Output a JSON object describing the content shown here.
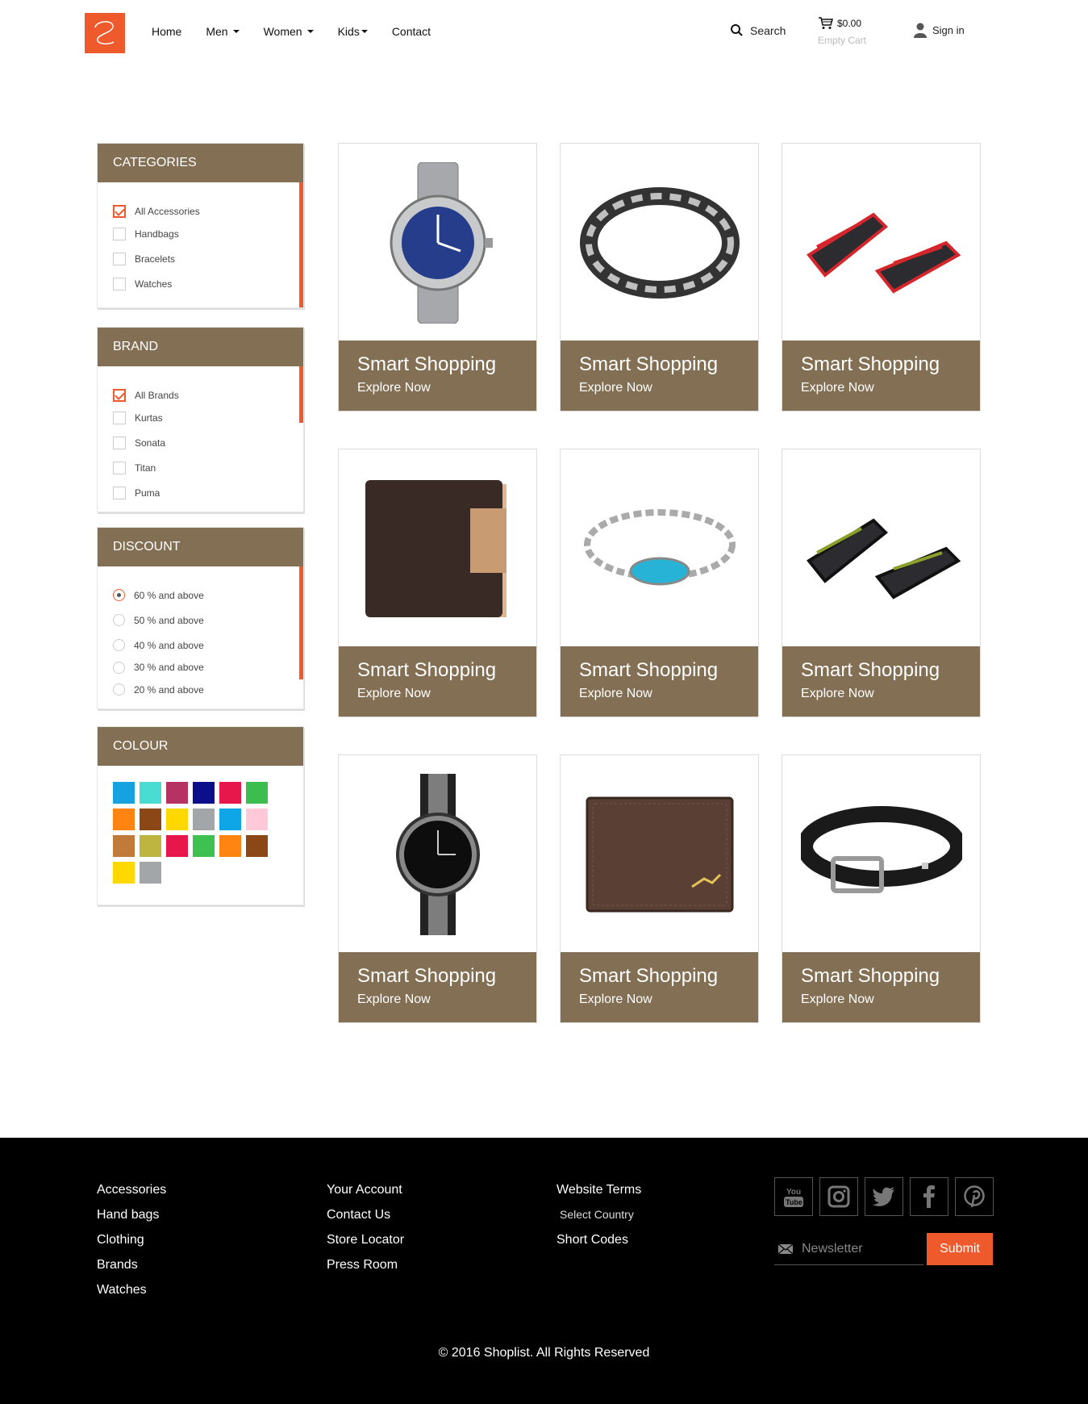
{
  "nav": {
    "home": "Home",
    "men": "Men",
    "women": "Women",
    "kids": "Kids",
    "contact": "Contact"
  },
  "header": {
    "search": "Search",
    "cart_amount": "$0.00",
    "cart_status": "Empty Cart",
    "sign_in": "Sign in"
  },
  "categories": {
    "title": "CATEGORIES",
    "items": [
      {
        "label": "All Accessories",
        "checked": true
      },
      {
        "label": "Handbags",
        "checked": false
      },
      {
        "label": "Bracelets",
        "checked": false
      },
      {
        "label": "Watches",
        "checked": false
      }
    ]
  },
  "brand": {
    "title": "BRAND",
    "items": [
      {
        "label": "All Brands",
        "checked": true
      },
      {
        "label": "Kurtas",
        "checked": false
      },
      {
        "label": "Sonata",
        "checked": false
      },
      {
        "label": "Titan",
        "checked": false
      },
      {
        "label": "Puma",
        "checked": false
      }
    ]
  },
  "discount": {
    "title": "DISCOUNT",
    "items": [
      {
        "label": "60 % and above",
        "selected": true
      },
      {
        "label": "50 % and above",
        "selected": false
      },
      {
        "label": "40 % and above",
        "selected": false
      },
      {
        "label": "30 % and above",
        "selected": false
      },
      {
        "label": "20 % and above",
        "selected": false
      }
    ]
  },
  "colour": {
    "title": "COLOUR",
    "swatches": [
      "#16a1e0",
      "#48dcd2",
      "#b53263",
      "#0b0f8a",
      "#e8174b",
      "#3cbd4f",
      "#ff8412",
      "#8b4816",
      "#ffd800",
      "#a3a6a8",
      "#0ea6e6",
      "#ffc9d9",
      "#c07a3a",
      "#bdb53f",
      "#e8174b",
      "#3fc152",
      "#ff8412",
      "#8b4716",
      "#ffd800",
      "#a3a6a8"
    ]
  },
  "products": [
    {
      "title": "Smart Shopping",
      "subtitle": "Explore Now",
      "icon": "watch-icon"
    },
    {
      "title": "Smart Shopping",
      "subtitle": "Explore Now",
      "icon": "bracelet-icon"
    },
    {
      "title": "Smart Shopping",
      "subtitle": "Explore Now",
      "icon": "sandal-icon"
    },
    {
      "title": "Smart Shopping",
      "subtitle": "Explore Now",
      "icon": "wallet-icon"
    },
    {
      "title": "Smart Shopping",
      "subtitle": "Explore Now",
      "icon": "bracelet-icon"
    },
    {
      "title": "Smart Shopping",
      "subtitle": "Explore Now",
      "icon": "sandal-icon"
    },
    {
      "title": "Smart Shopping",
      "subtitle": "Explore Now",
      "icon": "watch-icon"
    },
    {
      "title": "Smart Shopping",
      "subtitle": "Explore Now",
      "icon": "wallet-icon"
    },
    {
      "title": "Smart Shopping",
      "subtitle": "Explore Now",
      "icon": "belt-icon"
    }
  ],
  "footer": {
    "col1": [
      "Accessories",
      "Hand bags",
      "Clothing",
      "Brands",
      "Watches"
    ],
    "col2": [
      "Your Account",
      "Contact Us",
      "Store Locator",
      "Press Room"
    ],
    "col3": [
      "Website Terms",
      "Select Country",
      "Short Codes"
    ],
    "newsletter_placeholder": "Newsletter",
    "submit": "Submit",
    "copyright": "© 2016 Shoplist. All Rights Reserved",
    "social": [
      "youtube-icon",
      "instagram-icon",
      "twitter-icon",
      "facebook-icon",
      "pinterest-icon"
    ]
  },
  "colors": {
    "accent": "#ee5a2c",
    "panel": "#836f53"
  }
}
